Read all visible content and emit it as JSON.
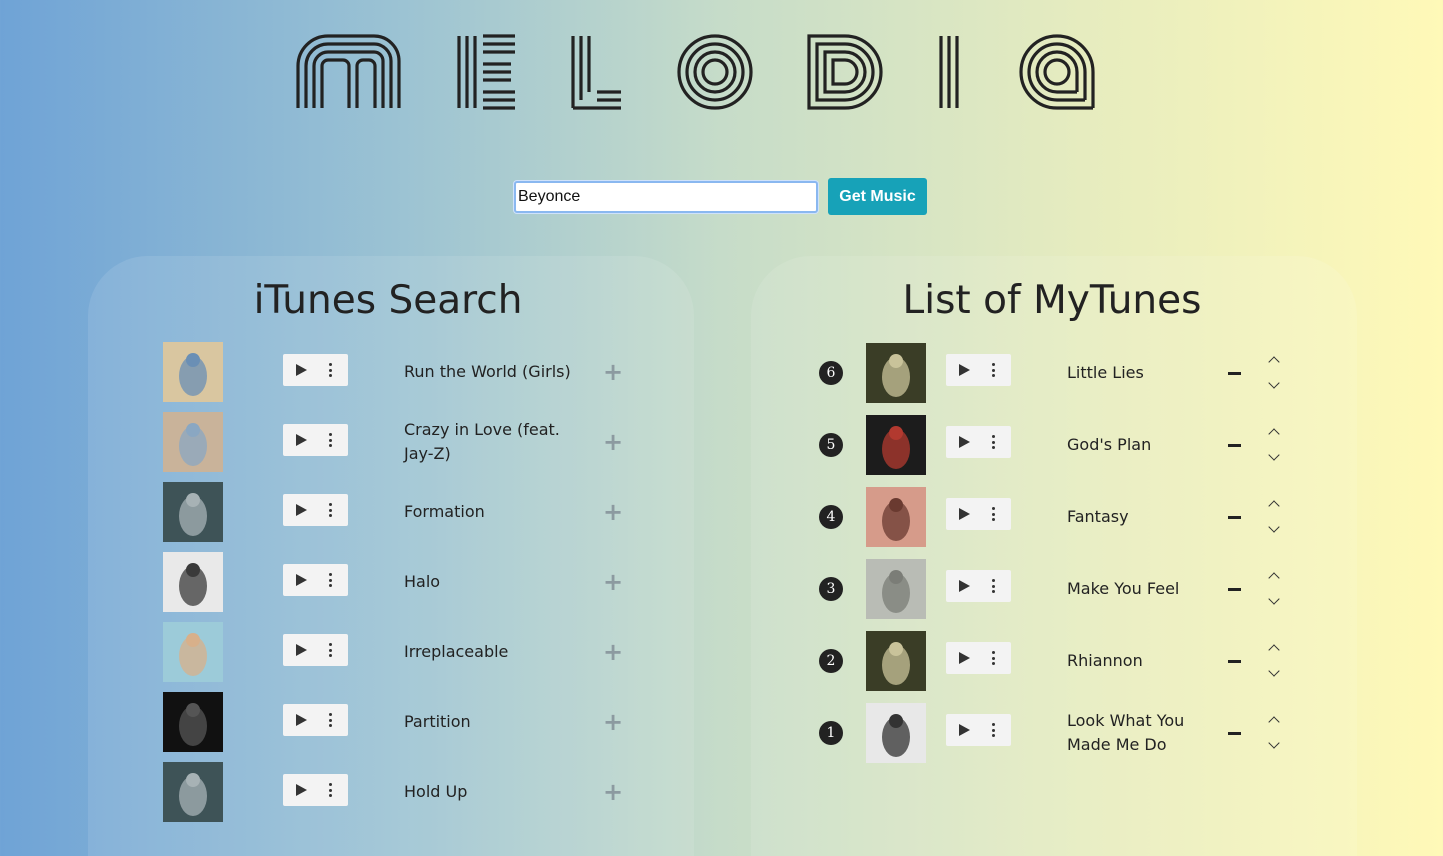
{
  "logo": {
    "text": "MELODIA"
  },
  "search": {
    "value": "Beyonce",
    "button_label": "Get Music"
  },
  "left_panel": {
    "title": "iTunes Search",
    "songs": [
      {
        "title": "Run the World (Girls)",
        "art": "beyonce-4-cover",
        "art_colors": [
          "#d9c6a0",
          "#6a8fb5"
        ]
      },
      {
        "title": "Crazy in Love (feat. Jay-Z)",
        "art": "dangerously-in-love-cover",
        "art_colors": [
          "#c9b39a",
          "#8aa7c2"
        ]
      },
      {
        "title": "Formation",
        "art": "lemonade-cover",
        "art_colors": [
          "#3e5357",
          "#a7b2b5"
        ]
      },
      {
        "title": "Halo",
        "art": "i-am-sasha-fierce-cover",
        "art_colors": [
          "#e9e9e9",
          "#3a3a3a"
        ]
      },
      {
        "title": "Irreplaceable",
        "art": "bday-cover",
        "art_colors": [
          "#9ccbd9",
          "#d8b08a"
        ]
      },
      {
        "title": "Partition",
        "art": "beyonce-self-titled-cover",
        "art_colors": [
          "#111111",
          "#555555"
        ]
      },
      {
        "title": "Hold Up",
        "art": "lemonade-cover",
        "art_colors": [
          "#3e5357",
          "#a7b2b5"
        ]
      }
    ]
  },
  "right_panel": {
    "title": "List of MyTunes",
    "songs": [
      {
        "rank": "6",
        "title": "Little Lies",
        "art": "fleetwood-mac-cover",
        "art_colors": [
          "#3a3d26",
          "#c9c39a"
        ]
      },
      {
        "rank": "5",
        "title": "God's Plan",
        "art": "scary-cover",
        "art_colors": [
          "#1c1c1c",
          "#b2392f"
        ]
      },
      {
        "rank": "4",
        "title": "Fantasy",
        "art": "fantasy-cover",
        "art_colors": [
          "#d69b8a",
          "#6a3a30"
        ]
      },
      {
        "rank": "3",
        "title": "Make You Feel",
        "art": "make-you-feel-cover",
        "art_colors": [
          "#b9bcb5",
          "#7b7d77"
        ]
      },
      {
        "rank": "2",
        "title": "Rhiannon",
        "art": "fleetwood-mac-cover",
        "art_colors": [
          "#3a3d26",
          "#c9c39a"
        ]
      },
      {
        "rank": "1",
        "title": "Look What You Made Me Do",
        "art": "reputation-cover",
        "art_colors": [
          "#e8e8e8",
          "#333333"
        ]
      }
    ]
  }
}
